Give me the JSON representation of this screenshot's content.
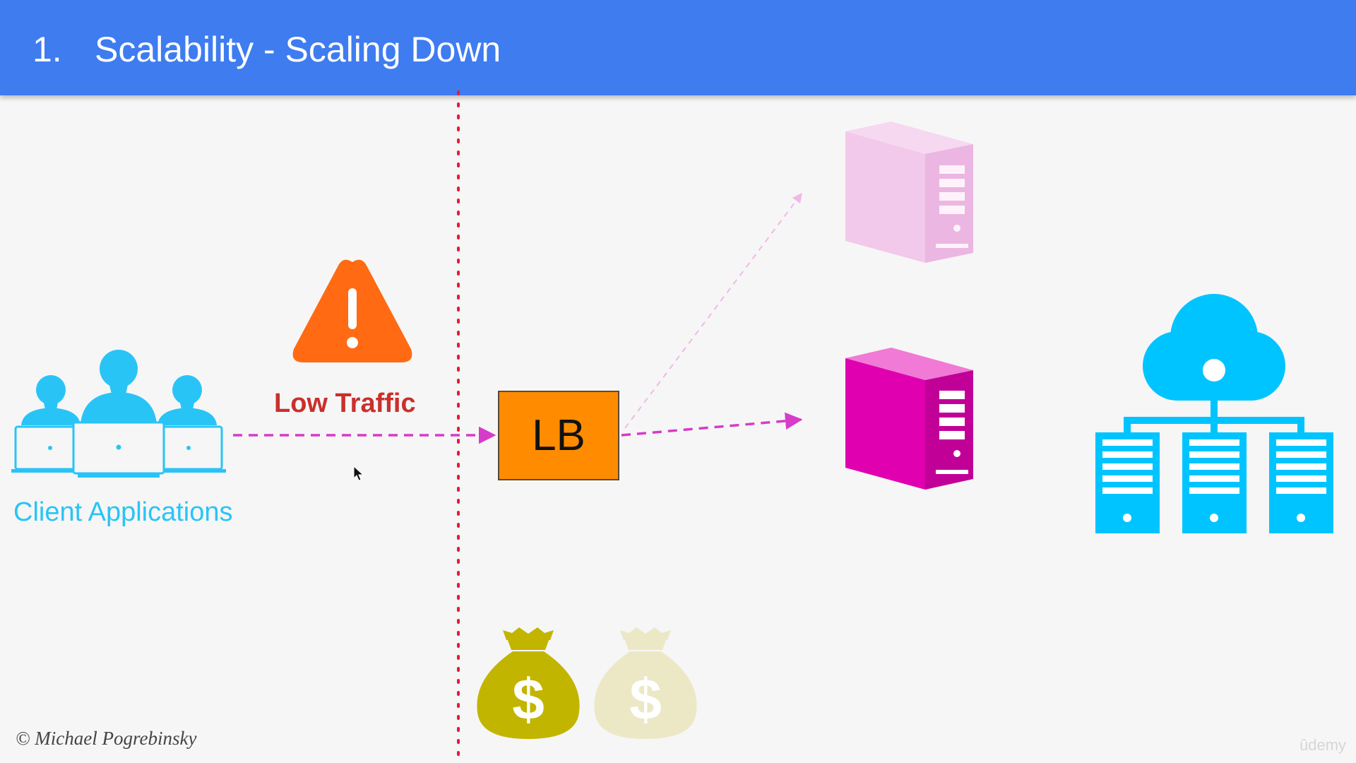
{
  "header": {
    "number": "1.",
    "title": "Scalability - Scaling Down"
  },
  "diagram": {
    "client_label": "Client Applications",
    "traffic_label": "Low Traffic",
    "lb_label": "LB"
  },
  "footer": {
    "copyright": "© Michael Pogrebinsky",
    "watermark": "ûdemy"
  },
  "colors": {
    "header": "#3e7cf0",
    "accent_blue": "#29c4f6",
    "arrow": "#d63bc9",
    "lb": "#ff8c00",
    "server_active": "#e000b0",
    "server_inactive": "#f2c9ea",
    "warning": "#ff6a13",
    "money_active": "#c2b500",
    "money_inactive": "#ece8c6",
    "boundary": "#e8193a"
  },
  "icons": [
    "users-laptops-icon",
    "warning-icon",
    "server-icon",
    "server-icon",
    "cloud-network-icon",
    "money-bag-icon",
    "money-bag-icon",
    "mouse-cursor-icon"
  ]
}
